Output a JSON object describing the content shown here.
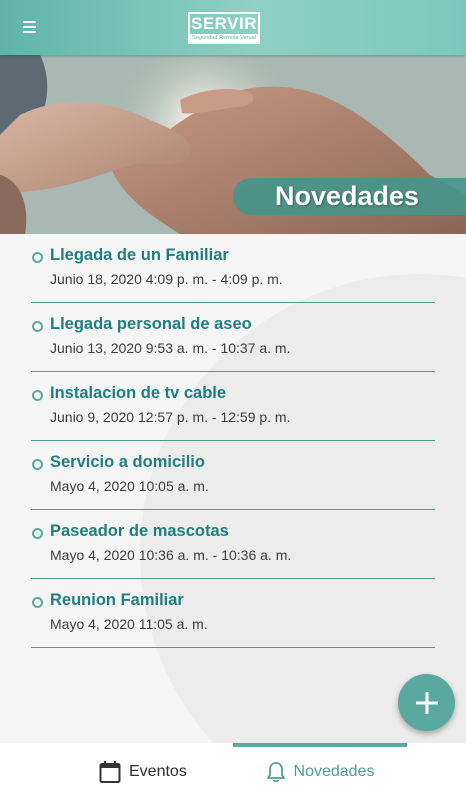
{
  "app": {
    "logo_main": "SERVIR",
    "logo_sub": "Seguridad Remota Virtual"
  },
  "hero": {
    "title": "Novedades"
  },
  "events": [
    {
      "title": "Llegada de un Familiar",
      "time": "Junio 18, 2020 4:09 p. m. - 4:09 p. m."
    },
    {
      "title": "Llegada personal de aseo",
      "time": "Junio 13, 2020 9:53 a. m. - 10:37 a. m."
    },
    {
      "title": "Instalacion de tv cable",
      "time": "Junio 9, 2020 12:57 p. m. - 12:59 p. m."
    },
    {
      "title": "Servicio a domicilio",
      "time": "Mayo 4, 2020 10:05 a. m."
    },
    {
      "title": "Paseador de mascotas",
      "time": "Mayo 4, 2020 10:36 a. m. - 10:36 a. m."
    },
    {
      "title": "Reunion Familiar",
      "time": "Mayo 4, 2020 11:05 a. m."
    }
  ],
  "tabs": {
    "events_label": "Eventos",
    "news_label": "Novedades",
    "active": "Novedades"
  },
  "icons": {
    "menu": "menu-icon",
    "add": "plus-icon",
    "events": "calendar-icon",
    "news": "bell-icon"
  },
  "colors": {
    "brand": "#5fb4a8",
    "accent": "#5aa9a1",
    "title_text": "#1f7f80"
  }
}
